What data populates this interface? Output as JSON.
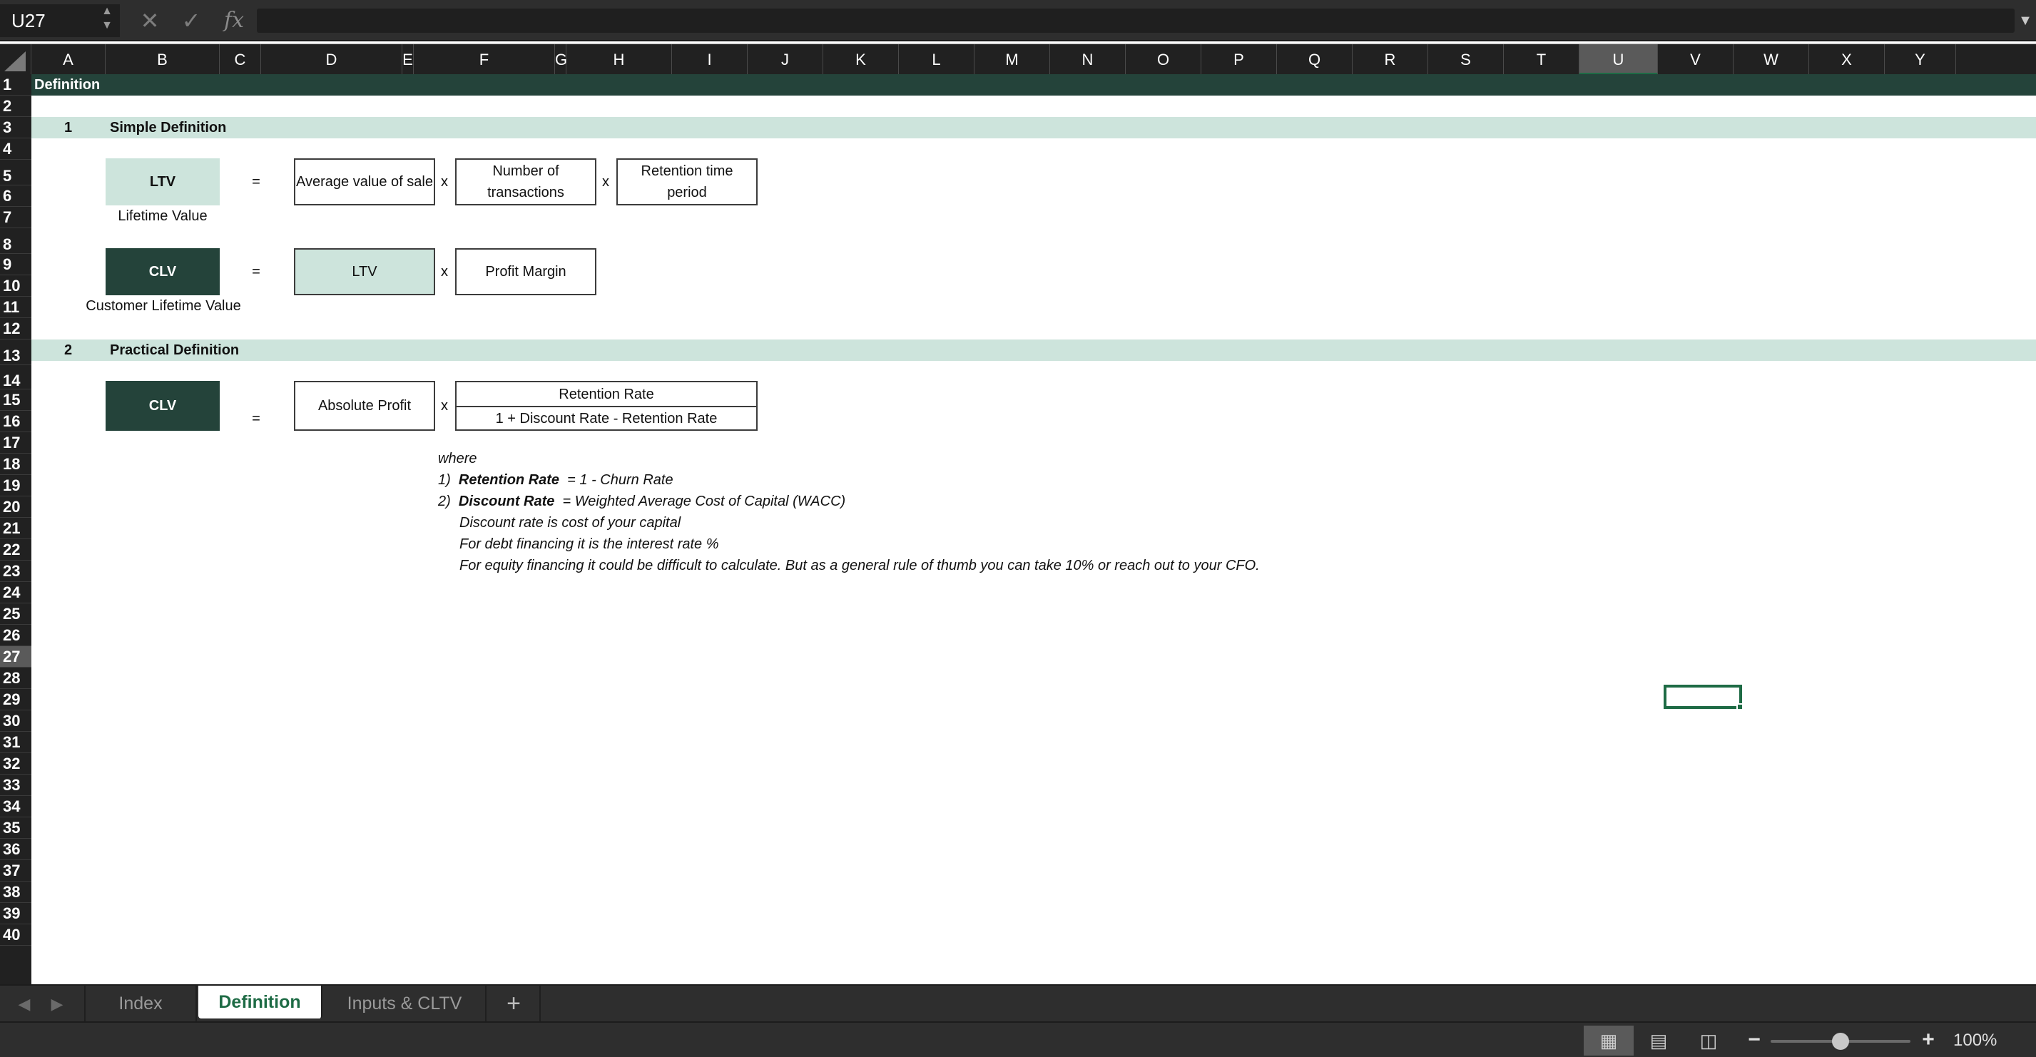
{
  "formula_bar": {
    "name_box": "U27",
    "cancel_icon": "close-icon",
    "confirm_icon": "checkmark-icon",
    "fx_label": "fx",
    "formula_value": ""
  },
  "columns": [
    "A",
    "B",
    "C",
    "D",
    "E",
    "F",
    "G",
    "H",
    "I",
    "J",
    "K",
    "L",
    "M",
    "N",
    "O",
    "P",
    "Q",
    "R",
    "S",
    "T",
    "U",
    "V",
    "W",
    "X",
    "Y"
  ],
  "selected_column": "U",
  "rows": [
    "1",
    "2",
    "3",
    "4",
    "5",
    "6",
    "7",
    "8",
    "9",
    "10",
    "11",
    "12",
    "13",
    "14",
    "15",
    "16",
    "17",
    "18",
    "19",
    "20",
    "21",
    "22",
    "23",
    "24",
    "25",
    "26",
    "27",
    "28",
    "29",
    "30",
    "31",
    "32",
    "33",
    "34",
    "35",
    "36",
    "37",
    "38",
    "39",
    "40"
  ],
  "selected_row": "27",
  "sheet": {
    "title": "Definition",
    "section1": {
      "number": "1",
      "title": "Simple Definition"
    },
    "ltv": {
      "label": "LTV",
      "caption": "Lifetime Value",
      "equals": "=",
      "term1": "Average value of sale",
      "times1": "x",
      "term2": "Number of transactions",
      "times2": "x",
      "term3": "Retention time period"
    },
    "clv_simple": {
      "label": "CLV",
      "caption": "Customer Lifetime Value",
      "equals": "=",
      "term1": "LTV",
      "times": "x",
      "term2": "Profit Margin"
    },
    "section2": {
      "number": "2",
      "title": "Practical Definition"
    },
    "clv_practical": {
      "label": "CLV",
      "equals": "=",
      "term1": "Absolute Profit",
      "times": "x",
      "numerator": "Retention Rate",
      "denominator": "1 + Discount Rate - Retention Rate"
    },
    "notes": {
      "where": "where",
      "n1_num": "1)",
      "n1_bold": "Retention Rate",
      "n1_text": "= 1 - Churn Rate",
      "n2_num": "2)",
      "n2_bold": "Discount Rate",
      "n2_text": "= Weighted Average Cost of Capital (WACC)",
      "line3": "Discount rate is cost of your capital",
      "line4": "For debt financing it is the interest rate %",
      "line5": "For equity financing it could be difficult to calculate. But as a general rule of thumb you can take 10% or reach out to your CFO."
    }
  },
  "tabs": {
    "index": "Index",
    "definition": "Definition",
    "inputs": "Inputs & CLTV",
    "add": "+"
  },
  "status": {
    "zoom": "100%",
    "zoom_minus": "−",
    "zoom_plus": "+",
    "zoom_level": 0.5
  },
  "colors": {
    "title_band": "#24433a",
    "section_band": "#cde4dc",
    "dark_box": "#24433a",
    "light_box": "#cde4dc",
    "accent": "#1e6b45"
  }
}
